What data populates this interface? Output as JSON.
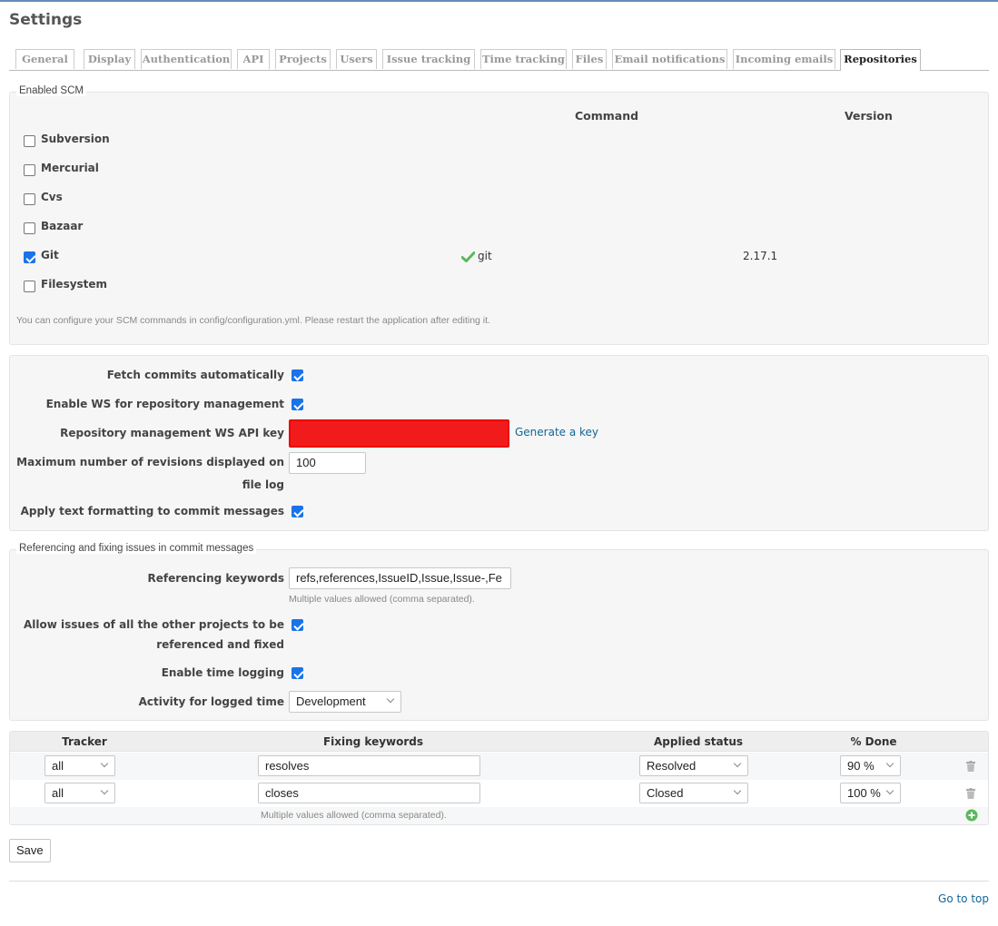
{
  "page": {
    "title": "Settings"
  },
  "tabs": [
    {
      "label": "General"
    },
    {
      "label": "Display"
    },
    {
      "label": "Authentication"
    },
    {
      "label": "API"
    },
    {
      "label": "Projects"
    },
    {
      "label": "Users"
    },
    {
      "label": "Issue tracking"
    },
    {
      "label": "Time tracking"
    },
    {
      "label": "Files"
    },
    {
      "label": "Email notifications"
    },
    {
      "label": "Incoming emails"
    },
    {
      "label": "Repositories",
      "selected": true
    }
  ],
  "scm": {
    "legend": "Enabled SCM",
    "col_command": "Command",
    "col_version": "Version",
    "items": [
      {
        "name": "Subversion",
        "checked": false,
        "command": "",
        "version": ""
      },
      {
        "name": "Mercurial",
        "checked": false,
        "command": "",
        "version": ""
      },
      {
        "name": "Cvs",
        "checked": false,
        "command": "",
        "version": ""
      },
      {
        "name": "Bazaar",
        "checked": false,
        "command": "",
        "version": ""
      },
      {
        "name": "Git",
        "checked": true,
        "command": "git",
        "version": "2.17.1"
      },
      {
        "name": "Filesystem",
        "checked": false,
        "command": "",
        "version": ""
      }
    ],
    "note": "You can configure your SCM commands in config/configuration.yml. Please restart the application after editing it."
  },
  "repo_settings": {
    "fetch_commits_label": "Fetch commits automatically",
    "fetch_commits_checked": true,
    "enable_ws_label": "Enable WS for repository management",
    "enable_ws_checked": true,
    "ws_api_key_label": "Repository management WS API key",
    "ws_api_key_value": "",
    "generate_key_link": "Generate a key",
    "max_revisions_label_1": "Maximum number of revisions displayed on",
    "max_revisions_label_2": "file log",
    "max_revisions_value": "100",
    "text_formatting_label": "Apply text formatting to commit messages",
    "text_formatting_checked": true
  },
  "referencing": {
    "legend": "Referencing and fixing issues in commit messages",
    "keywords_label": "Referencing keywords",
    "keywords_value": "refs,references,IssueID,Issue,Issue-,Fe",
    "keywords_hint": "Multiple values allowed (comma separated).",
    "cross_project_label_1": "Allow issues of all the other projects to be",
    "cross_project_label_2": "referenced and fixed",
    "cross_project_checked": true,
    "time_logging_label": "Enable time logging",
    "time_logging_checked": true,
    "activity_label": "Activity for logged time",
    "activity_value": "Development"
  },
  "fixing_table": {
    "headers": {
      "tracker": "Tracker",
      "keywords": "Fixing keywords",
      "status": "Applied status",
      "done": "% Done"
    },
    "rows": [
      {
        "tracker": "all",
        "keywords": "resolves",
        "status": "Resolved",
        "done": "90 %"
      },
      {
        "tracker": "all",
        "keywords": "closes",
        "status": "Closed",
        "done": "100 %"
      }
    ],
    "hint": "Multiple values allowed (comma separated)."
  },
  "actions": {
    "save_label": "Save"
  },
  "footer": {
    "go_to_top": "Go to top"
  },
  "colors": {
    "api_key_highlight": "#f21b1b",
    "link": "#116699",
    "check_green": "#5cb85c",
    "add_green": "#5cb85c"
  }
}
